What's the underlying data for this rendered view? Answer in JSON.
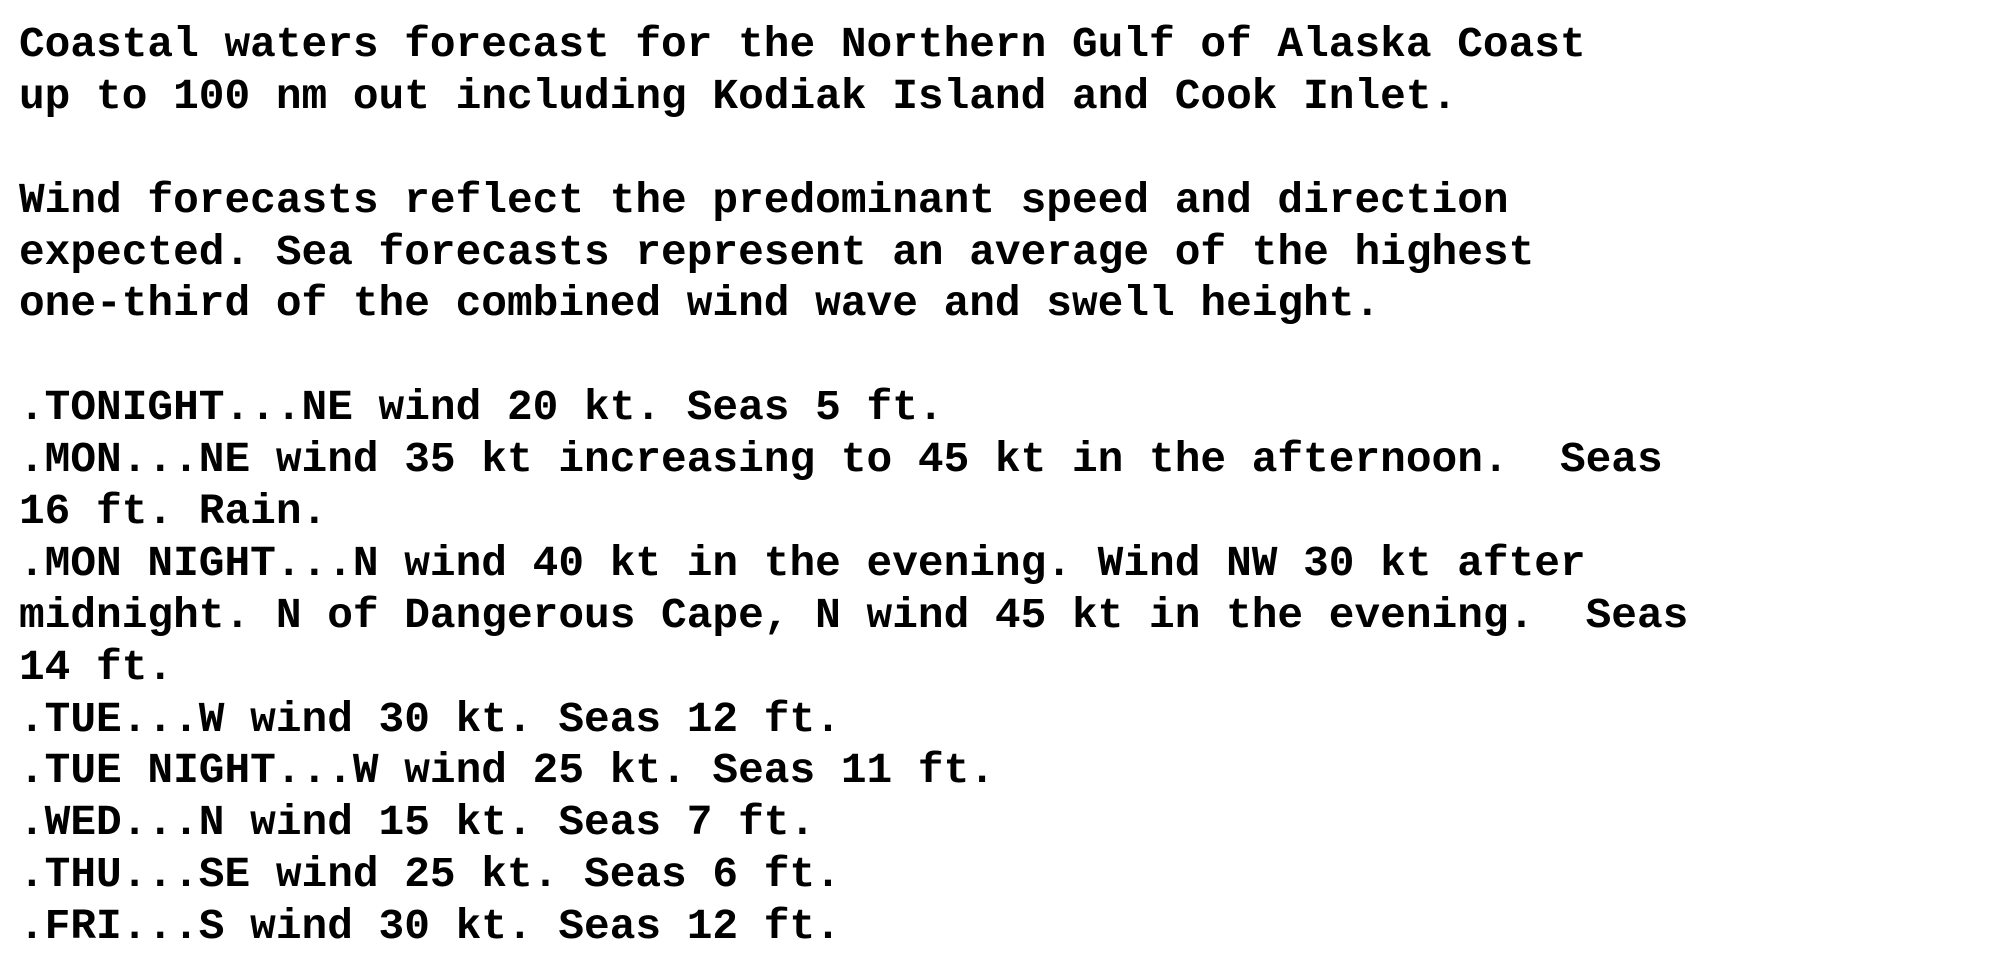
{
  "document": {
    "intro": [
      "Coastal waters forecast for the Northern Gulf of Alaska Coast",
      "up to 100 nm out including Kodiak Island and Cook Inlet."
    ],
    "explanation": [
      "Wind forecasts reflect the predominant speed and direction",
      "expected. Sea forecasts represent an average of the highest",
      "one-third of the combined wind wave and swell height."
    ],
    "forecast_lines": [
      ".TONIGHT...NE wind 20 kt. Seas 5 ft.",
      ".MON...NE wind 35 kt increasing to 45 kt in the afternoon.  Seas",
      "16 ft. Rain.",
      ".MON NIGHT...N wind 40 kt in the evening. Wind NW 30 kt after",
      "midnight. N of Dangerous Cape, N wind 45 kt in the evening.  Seas",
      "14 ft.",
      ".TUE...W wind 30 kt. Seas 12 ft.",
      ".TUE NIGHT...W wind 25 kt. Seas 11 ft.",
      ".WED...N wind 15 kt. Seas 7 ft.",
      ".THU...SE wind 25 kt. Seas 6 ft.",
      ".FRI...S wind 30 kt. Seas 12 ft."
    ],
    "periods": [
      {
        "period": "TONIGHT",
        "wind_dir": "NE",
        "wind_kt": "20",
        "seas_ft": "5"
      },
      {
        "period": "MON",
        "wind_dir": "NE",
        "wind_kt": "35 increasing to 45",
        "seas_ft": "16",
        "weather": "Rain"
      },
      {
        "period": "MON NIGHT",
        "wind_dir": "N then NW",
        "wind_kt": "40 then 30",
        "seas_ft": "14",
        "note": "N of Dangerous Cape, N wind 45 kt in the evening"
      },
      {
        "period": "TUE",
        "wind_dir": "W",
        "wind_kt": "30",
        "seas_ft": "12"
      },
      {
        "period": "TUE NIGHT",
        "wind_dir": "W",
        "wind_kt": "25",
        "seas_ft": "11"
      },
      {
        "period": "WED",
        "wind_dir": "N",
        "wind_kt": "15",
        "seas_ft": "7"
      },
      {
        "period": "THU",
        "wind_dir": "SE",
        "wind_kt": "25",
        "seas_ft": "6"
      },
      {
        "period": "FRI",
        "wind_dir": "S",
        "wind_kt": "30",
        "seas_ft": "12"
      }
    ]
  },
  "colors": {
    "background": "#ffffff",
    "text": "#000000"
  }
}
